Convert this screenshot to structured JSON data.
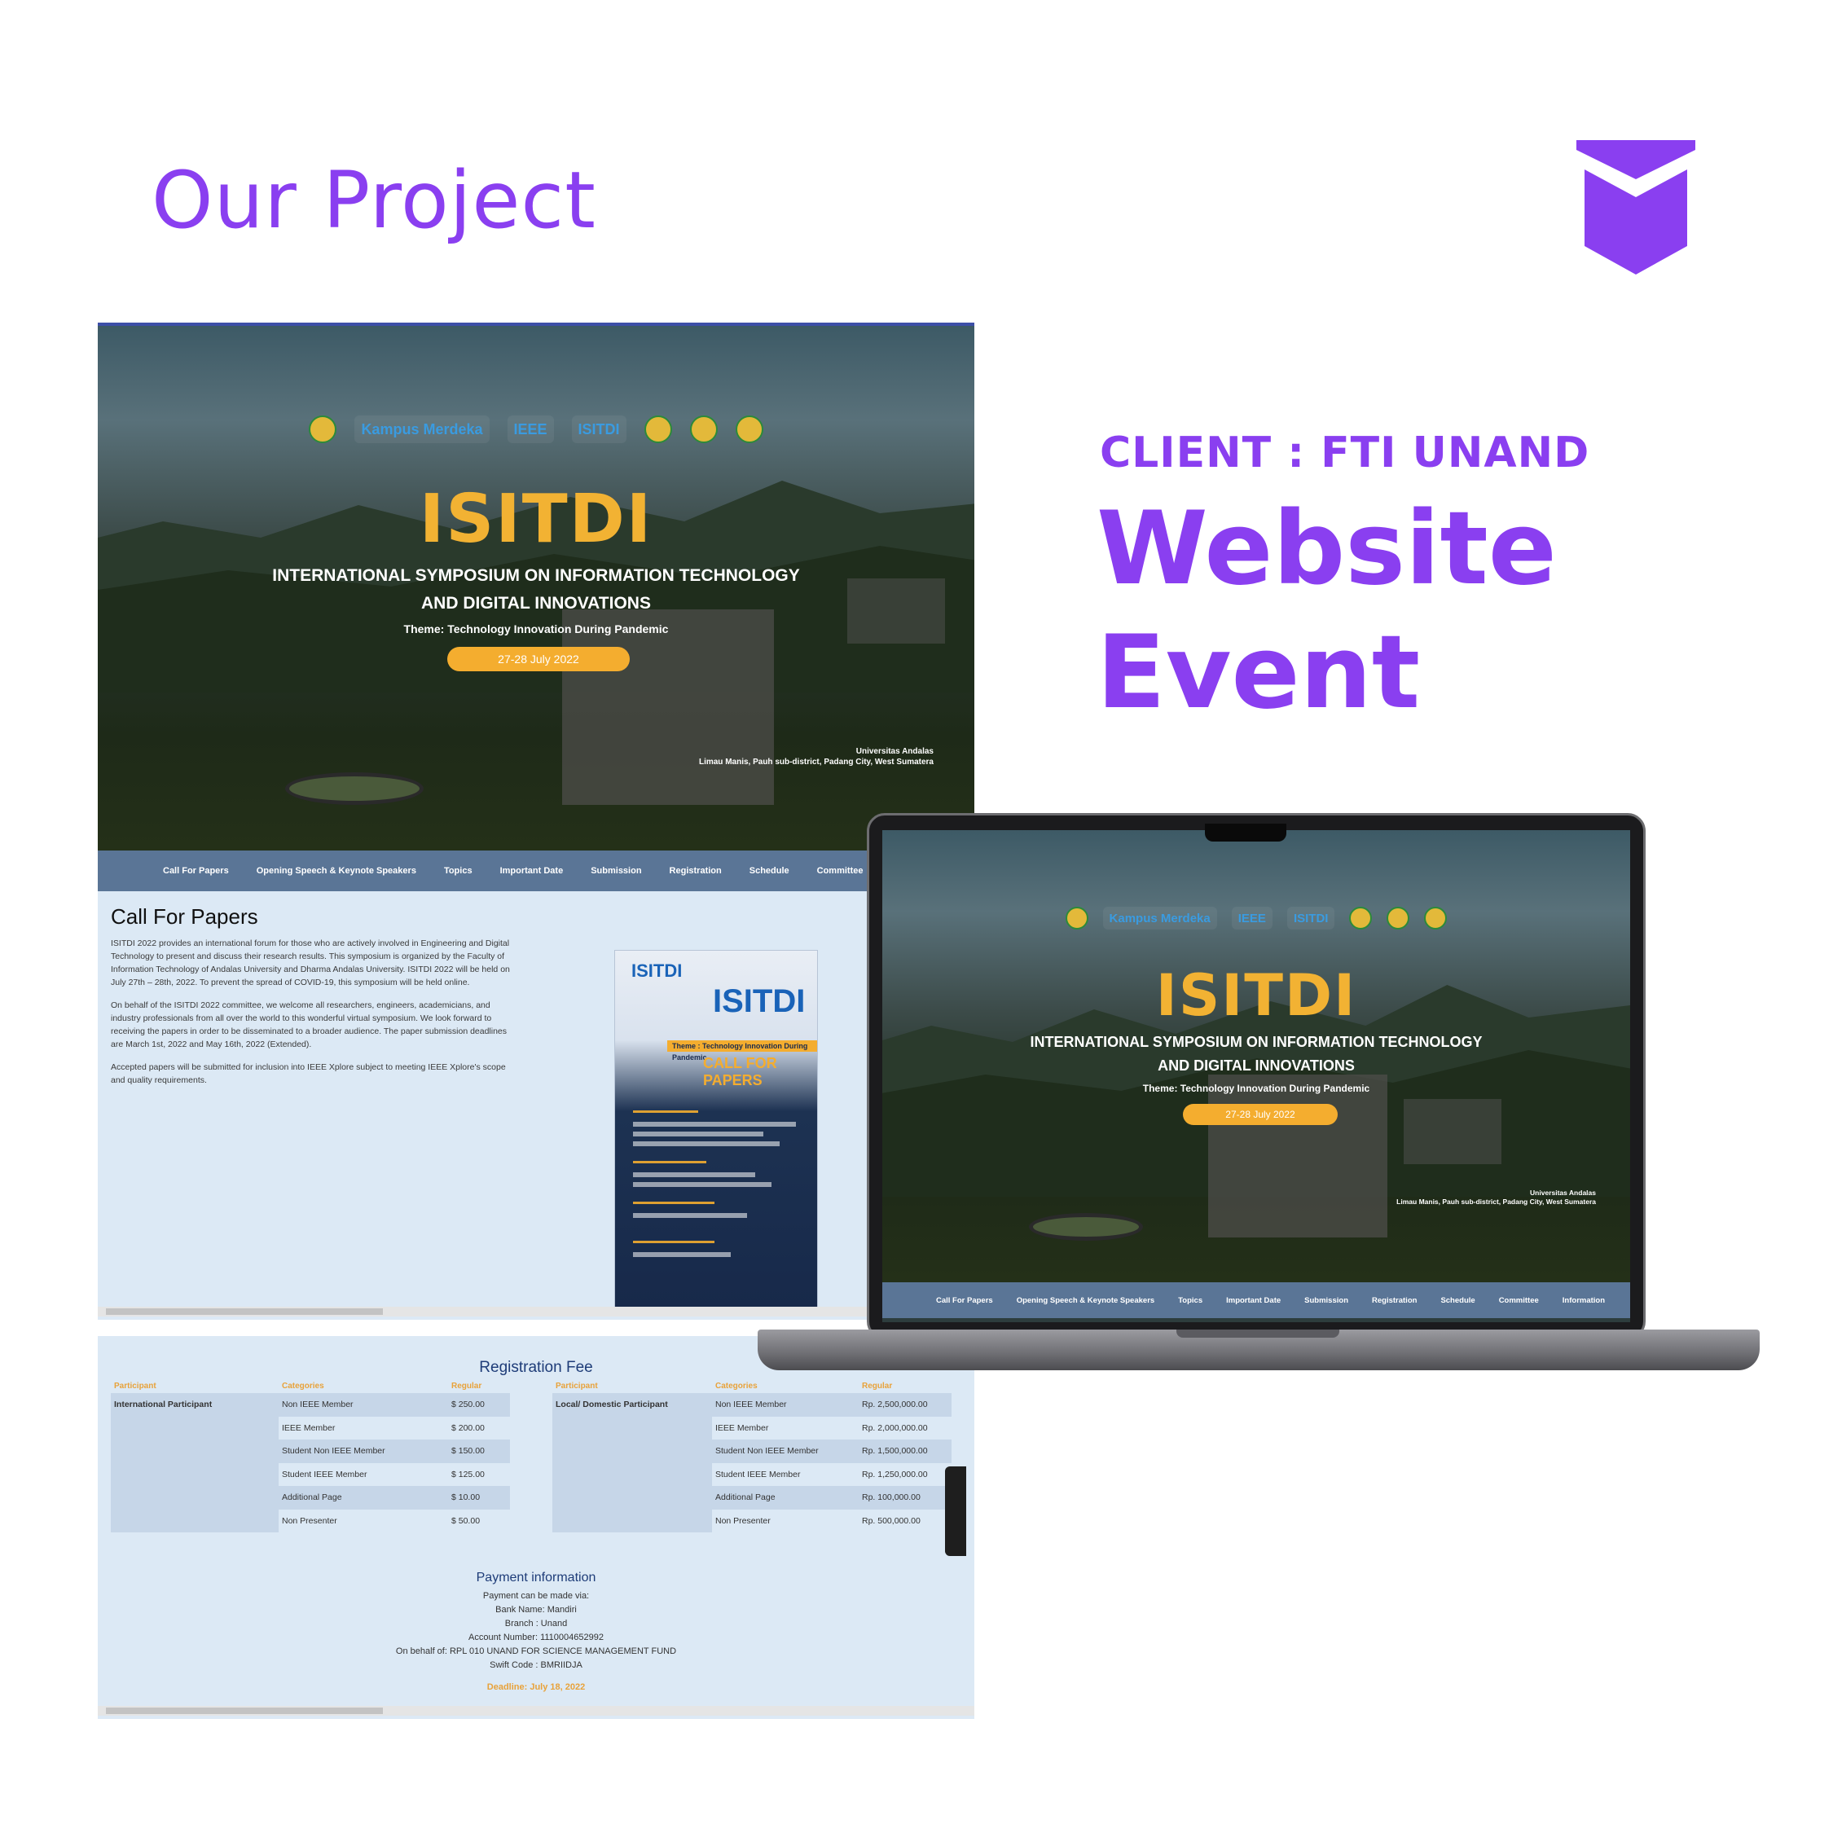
{
  "heading": "Our Project",
  "client": "CLIENT : FTI UNAND",
  "project_title": [
    "Website",
    "Event"
  ],
  "brand_color": "#8a3ff0",
  "site": {
    "logos": [
      "Kampus Merdeka",
      "IEEE",
      "ISITDI"
    ],
    "hero_title": "ISITDI",
    "hero_subtitle_line1": "INTERNATIONAL SYMPOSIUM ON INFORMATION TECHNOLOGY",
    "hero_subtitle_line2": "AND DIGITAL INNOVATIONS",
    "theme": "Theme: Technology Innovation During Pandemic",
    "date": "27-28 July 2022",
    "location_line1": "Universitas Andalas",
    "location_line2": "Limau Manis, Pauh sub-district, Padang City, West Sumatera",
    "nav": [
      "Call For Papers",
      "Opening Speech & Keynote Speakers",
      "Topics",
      "Important Date",
      "Submission",
      "Registration",
      "Schedule",
      "Committee",
      "Information"
    ],
    "cfp_title": "Call For Papers",
    "cfp_p1": "ISITDI 2022 provides an international forum for those who are actively involved in Engineering and Digital Technology to present and discuss their research results. This symposium is organized by the Faculty of Information Technology of Andalas University and Dharma Andalas University. ISITDI 2022 will be held on July 27th – 28th, 2022. To prevent the spread of COVID-19, this symposium will be held online.",
    "cfp_p2": "On behalf of the ISITDI 2022 committee, we welcome all researchers, engineers, academicians, and industry professionals from all over the world to this wonderful virtual symposium. We look forward to receiving the papers in order to be disseminated to a broader audience. The paper submission deadlines are March 1st, 2022 and May 16th, 2022 (Extended).",
    "cfp_p3": "Accepted papers will be submitted for inclusion into IEEE Xplore subject to meeting IEEE Xplore's scope and quality requirements.",
    "poster": {
      "logo": "ISITDI",
      "big": "ISITDI",
      "theme_bar": "Theme : Technology Innovation During Pandemic",
      "cfp": "CALL FOR PAPERS"
    }
  },
  "registration": {
    "title": "Registration Fee",
    "headers": [
      "Participant",
      "Categories",
      "Regular"
    ],
    "international": {
      "participant": "International Participant",
      "rows": [
        [
          "Non IEEE Member",
          "$ 250.00"
        ],
        [
          "IEEE Member",
          "$ 200.00"
        ],
        [
          "Student Non IEEE Member",
          "$ 150.00"
        ],
        [
          "Student IEEE Member",
          "$ 125.00"
        ],
        [
          "Additional Page",
          "$ 10.00"
        ],
        [
          "Non Presenter",
          "$ 50.00"
        ]
      ]
    },
    "domestic": {
      "participant": "Local/ Domestic Participant",
      "rows": [
        [
          "Non IEEE Member",
          "Rp. 2,500,000.00"
        ],
        [
          "IEEE Member",
          "Rp. 2,000,000.00"
        ],
        [
          "Student Non IEEE Member",
          "Rp. 1,500,000.00"
        ],
        [
          "Student IEEE Member",
          "Rp. 1,250,000.00"
        ],
        [
          "Additional Page",
          "Rp. 100,000.00"
        ],
        [
          "Non Presenter",
          "Rp. 500,000.00"
        ]
      ]
    }
  },
  "payment": {
    "title": "Payment information",
    "lines": [
      "Payment can be made via:",
      "Bank Name: Mandiri",
      "Branch : Unand",
      "Account Number: 1110004652992",
      "On behalf of: RPL 010 UNAND FOR SCIENCE MANAGEMENT FUND",
      "Swift Code : BMRIIDJA"
    ],
    "deadline": "Deadline: July 18, 2022"
  }
}
